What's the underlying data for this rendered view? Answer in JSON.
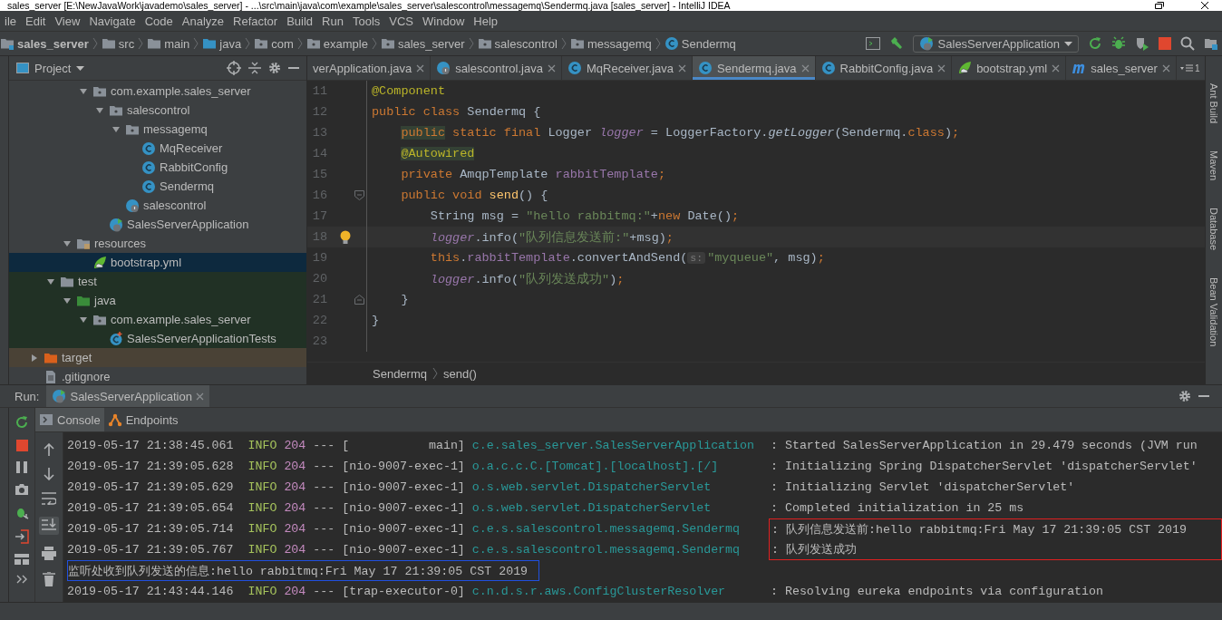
{
  "window": {
    "title": "sales_server [E:\\NewJavaWork\\javademo\\sales_server] - ...\\src\\main\\java\\com\\example\\sales_server\\salescontrol\\messagemq\\Sendermq.java [sales_server] - IntelliJ IDEA"
  },
  "menu": [
    "ile",
    "Edit",
    "View",
    "Navigate",
    "Code",
    "Analyze",
    "Refactor",
    "Build",
    "Run",
    "Tools",
    "VCS",
    "Window",
    "Help"
  ],
  "navbar": {
    "breadcrumbs": [
      {
        "label": "sales_server",
        "kind": "module",
        "bold": true
      },
      {
        "label": "src",
        "kind": "folder",
        "bold": false
      },
      {
        "label": "main",
        "kind": "folder",
        "bold": false
      },
      {
        "label": "java",
        "kind": "source",
        "bold": false
      },
      {
        "label": "com",
        "kind": "package",
        "bold": false
      },
      {
        "label": "example",
        "kind": "package",
        "bold": false
      },
      {
        "label": "sales_server",
        "kind": "package",
        "bold": false
      },
      {
        "label": "salescontrol",
        "kind": "package",
        "bold": false
      },
      {
        "label": "messagemq",
        "kind": "package",
        "bold": false
      },
      {
        "label": "Sendermq",
        "kind": "class",
        "bold": false
      }
    ],
    "run_config": "SalesServerApplication"
  },
  "project": {
    "title": "Project",
    "tree": [
      {
        "children": [
          {
            "children": [
              {
                "children": [
                  {
                    "label": "com.example.sales_server",
                    "kind": "package",
                    "expanded": true,
                    "selected": false,
                    "children": [
                      {
                        "label": "salescontrol",
                        "kind": "package",
                        "expanded": true,
                        "selected": false,
                        "children": [
                          {
                            "label": "messagemq",
                            "kind": "package",
                            "expanded": true,
                            "selected": false,
                            "children": [
                              {
                                "label": "MqReceiver",
                                "kind": "class",
                                "selected": false
                              },
                              {
                                "label": "RabbitConfig",
                                "kind": "class",
                                "selected": false
                              },
                              {
                                "label": "Sendermq",
                                "kind": "class",
                                "selected": false
                              }
                            ]
                          },
                          {
                            "label": "salescontrol",
                            "kind": "spring-class",
                            "selected": false
                          }
                        ]
                      },
                      {
                        "label": "SalesServerApplication",
                        "kind": "spring-app",
                        "selected": false
                      }
                    ]
                  }
                ]
              },
              {
                "label": "resources",
                "kind": "resources",
                "expanded": true,
                "selected": false,
                "children": [
                  {
                    "label": "bootstrap.yml",
                    "kind": "yml",
                    "selected": true
                  }
                ]
              }
            ]
          },
          {
            "label": "test",
            "kind": "test-folder",
            "expanded": true,
            "selected": false,
            "children": [
              {
                "label": "java",
                "kind": "test-source",
                "expanded": true,
                "selected": false,
                "children": [
                  {
                    "label": "com.example.sales_server",
                    "kind": "test-package",
                    "expanded": true,
                    "selected": false,
                    "children": [
                      {
                        "label": "SalesServerApplicationTests",
                        "kind": "test-class",
                        "selected": false
                      }
                    ]
                  }
                ]
              }
            ]
          }
        ]
      },
      {
        "label": "target",
        "kind": "excluded-folder",
        "expanded": false,
        "selected": false
      },
      {
        "label": ".gitignore",
        "kind": "file",
        "selected": false
      }
    ]
  },
  "editor": {
    "tabs": [
      {
        "label": "verApplication.java",
        "kind": "partial",
        "selected": false
      },
      {
        "label": "salescontrol.java",
        "kind": "spring-class",
        "selected": false
      },
      {
        "label": "MqReceiver.java",
        "kind": "class",
        "selected": false
      },
      {
        "label": "Sendermq.java",
        "kind": "class",
        "selected": true
      },
      {
        "label": "RabbitConfig.java",
        "kind": "class",
        "selected": false
      },
      {
        "label": "bootstrap.yml",
        "kind": "yml",
        "selected": false
      },
      {
        "label": "sales_server",
        "kind": "maven",
        "selected": false
      }
    ],
    "overflow_count": "1",
    "lines": [
      {
        "number": "11",
        "current": false,
        "fold": false,
        "tokens": [
          {
            "kind": "ann",
            "text": "@Component"
          }
        ]
      },
      {
        "number": "12",
        "current": false,
        "fold": false,
        "tokens": [
          {
            "kind": "kw",
            "text": "public class "
          },
          {
            "kind": "plain",
            "text": "Sendermq {"
          }
        ],
        "children": [
          {
            "number": "13",
            "current": false,
            "fold": false,
            "tokens": [
              {
                "kind": "kw-warn",
                "text": "public"
              },
              {
                "kind": "kw",
                "text": " static final "
              },
              {
                "kind": "plain",
                "text": "Logger "
              },
              {
                "kind": "field-static",
                "text": "logger"
              },
              {
                "kind": "plain",
                "text": " = LoggerFactory."
              },
              {
                "kind": "call-static",
                "text": "getLogger"
              },
              {
                "kind": "plain",
                "text": "(Sendermq."
              },
              {
                "kind": "kw",
                "text": "class"
              },
              {
                "kind": "plain",
                "text": ")"
              },
              {
                "kind": "kw",
                "text": ";"
              }
            ]
          },
          {
            "number": "14",
            "current": false,
            "fold": false,
            "tokens": [
              {
                "kind": "ann-warn",
                "text": "@Autowired"
              }
            ]
          },
          {
            "number": "15",
            "current": false,
            "fold": false,
            "tokens": [
              {
                "kind": "kw",
                "text": "private "
              },
              {
                "kind": "plain",
                "text": "AmqpTemplate "
              },
              {
                "kind": "field",
                "text": "rabbitTemplate"
              },
              {
                "kind": "kw",
                "text": ";"
              }
            ]
          },
          {
            "number": "16",
            "current": false,
            "fold": true,
            "tokens": [
              {
                "kind": "kw",
                "text": "public void "
              },
              {
                "kind": "decl",
                "text": "send"
              },
              {
                "kind": "plain",
                "text": "() {"
              }
            ],
            "children": [
              {
                "number": "17",
                "current": false,
                "fold": false,
                "tokens": [
                  {
                    "kind": "plain",
                    "text": "String msg = "
                  },
                  {
                    "kind": "str",
                    "text": "\"hello rabbitmq:\""
                  },
                  {
                    "kind": "plain",
                    "text": "+"
                  },
                  {
                    "kind": "kw",
                    "text": "new "
                  },
                  {
                    "kind": "plain",
                    "text": "Date()"
                  },
                  {
                    "kind": "kw",
                    "text": ";"
                  }
                ]
              },
              {
                "number": "18",
                "current": true,
                "fold": false,
                "tokens": [
                  {
                    "kind": "field-static",
                    "text": "logger"
                  },
                  {
                    "kind": "plain",
                    "text": ".info("
                  },
                  {
                    "kind": "str",
                    "text": "\"队列信息发送前:\""
                  },
                  {
                    "kind": "plain",
                    "text": "+msg)"
                  },
                  {
                    "kind": "kw",
                    "text": ";"
                  }
                ]
              },
              {
                "number": "19",
                "current": false,
                "fold": false,
                "tokens": [
                  {
                    "kind": "kw",
                    "text": "this"
                  },
                  {
                    "kind": "plain",
                    "text": "."
                  },
                  {
                    "kind": "field",
                    "text": "rabbitTemplate"
                  },
                  {
                    "kind": "plain",
                    "text": ".convertAndSend("
                  },
                  {
                    "kind": "hint",
                    "text": "s:"
                  },
                  {
                    "kind": "str",
                    "text": "\"myqueue\""
                  },
                  {
                    "kind": "plain",
                    "text": ", msg)"
                  },
                  {
                    "kind": "kw",
                    "text": ";"
                  }
                ]
              },
              {
                "number": "20",
                "current": false,
                "fold": false,
                "tokens": [
                  {
                    "kind": "field-static",
                    "text": "logger"
                  },
                  {
                    "kind": "plain",
                    "text": ".info("
                  },
                  {
                    "kind": "str",
                    "text": "\"队列发送成功\""
                  },
                  {
                    "kind": "plain",
                    "text": ")"
                  },
                  {
                    "kind": "kw",
                    "text": ";"
                  }
                ]
              }
            ]
          },
          {
            "number": "21",
            "current": false,
            "fold": true,
            "tokens": [
              {
                "kind": "plain",
                "text": "}"
              }
            ]
          }
        ]
      },
      {
        "number": "22",
        "current": false,
        "fold": false,
        "tokens": [
          {
            "kind": "plain",
            "text": "}"
          }
        ]
      },
      {
        "number": "23",
        "current": false,
        "fold": false
      }
    ],
    "breadcrumbs": [
      "Sendermq",
      "send()"
    ]
  },
  "right_stripe": [
    "Ant Build",
    "Maven",
    "Database",
    "Bean Validation"
  ],
  "run": {
    "label": "Run:",
    "tab": "SalesServerApplication",
    "subtabs": [
      {
        "label": "Console",
        "kind": "console",
        "selected": true
      },
      {
        "label": "Endpoints",
        "kind": "endpoints",
        "selected": false
      }
    ],
    "rows": [
      {
        "kind": "log",
        "time": "2019-05-17 21:38:45.061",
        "level": "INFO",
        "pid": "204",
        "sep": "---",
        "thread": "[           main]",
        "logger": "c.e.sales_server.SalesServerApplication",
        "message": ": Started SalesServerApplication in 29.479 seconds (JVM run"
      },
      {
        "kind": "log",
        "time": "2019-05-17 21:39:05.628",
        "level": "INFO",
        "pid": "204",
        "sep": "---",
        "thread": "[nio-9007-exec-1]",
        "logger": "o.a.c.c.C.[Tomcat].[localhost].[/]",
        "message": ": Initializing Spring DispatcherServlet 'dispatcherServlet'"
      },
      {
        "kind": "log",
        "time": "2019-05-17 21:39:05.629",
        "level": "INFO",
        "pid": "204",
        "sep": "---",
        "thread": "[nio-9007-exec-1]",
        "logger": "o.s.web.servlet.DispatcherServlet",
        "message": ": Initializing Servlet 'dispatcherServlet'"
      },
      {
        "kind": "log",
        "time": "2019-05-17 21:39:05.654",
        "level": "INFO",
        "pid": "204",
        "sep": "---",
        "thread": "[nio-9007-exec-1]",
        "logger": "o.s.web.servlet.DispatcherServlet",
        "message": ": Completed initialization in 25 ms"
      },
      {
        "kind": "log",
        "time": "2019-05-17 21:39:05.714",
        "level": "INFO",
        "pid": "204",
        "sep": "---",
        "thread": "[nio-9007-exec-1]",
        "logger": "c.e.s.salescontrol.messagemq.Sendermq",
        "message": ": 队列信息发送前:hello rabbitmq:Fri May 17 21:39:05 CST 2019",
        "color": "#e02020"
      },
      {
        "kind": "log",
        "time": "2019-05-17 21:39:05.767",
        "level": "INFO",
        "pid": "204",
        "sep": "---",
        "thread": "[nio-9007-exec-1]",
        "logger": "c.e.s.salescontrol.messagemq.Sendermq",
        "message": ": 队列发送成功",
        "color": "#e02020"
      },
      {
        "kind": "plain",
        "message": "监听处收到队列发送的信息:hello rabbitmq:Fri May 17 21:39:05 CST 2019",
        "color": "#2050e0"
      },
      {
        "kind": "log",
        "time": "2019-05-17 21:43:44.146",
        "level": "INFO",
        "pid": "204",
        "sep": "---",
        "thread": "[trap-executor-0]",
        "logger": "c.n.d.s.r.aws.ConfigClusterResolver",
        "message": ": Resolving eureka endpoints via configuration"
      }
    ]
  }
}
